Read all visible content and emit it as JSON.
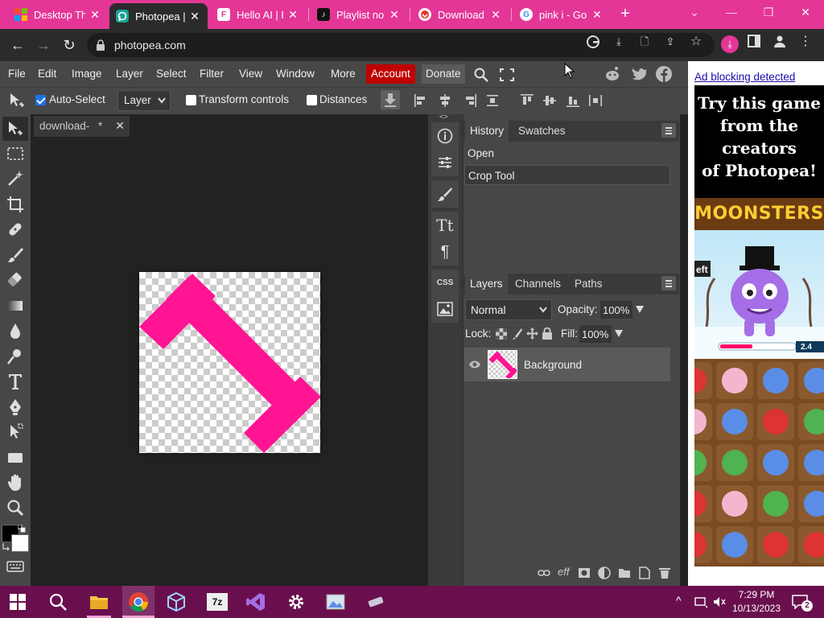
{
  "browser": {
    "tabs": [
      {
        "title": "Desktop Th",
        "favicon": "windows-flag-icon",
        "active": false
      },
      {
        "title": "Photopea |",
        "favicon": "photopea-icon",
        "active": true
      },
      {
        "title": "Hello AI | F",
        "favicon": "f-logo-icon",
        "active": false
      },
      {
        "title": "Playlist no",
        "favicon": "tiktok-icon",
        "active": false
      },
      {
        "title": "Download",
        "favicon": "download-site-icon",
        "active": false
      },
      {
        "title": "pink i - Go",
        "favicon": "google-icon",
        "active": false
      }
    ],
    "url": "photopea.com",
    "accent": "#e43697"
  },
  "menu": {
    "items": [
      "File",
      "Edit",
      "Image",
      "Layer",
      "Select",
      "Filter",
      "View",
      "Window",
      "More"
    ],
    "account": "Account",
    "donate": "Donate"
  },
  "options": {
    "auto_select": "Auto-Select",
    "auto_select_checked": true,
    "target": "Layer",
    "transform_controls": "Transform controls",
    "distances": "Distances"
  },
  "document": {
    "tab_title": "download-",
    "modified": "*",
    "art_color": "#ff1493"
  },
  "history": {
    "tabs": [
      "History",
      "Swatches"
    ],
    "items": [
      "Open",
      "Crop Tool"
    ]
  },
  "layers": {
    "tabs": [
      "Layers",
      "Channels",
      "Paths"
    ],
    "blend_mode": "Normal",
    "opacity_label": "Opacity:",
    "opacity": "100%",
    "lock_label": "Lock:",
    "fill_label": "Fill:",
    "fill": "100%",
    "layer_name": "Background"
  },
  "ad": {
    "notice": "Ad blocking detected",
    "headline": [
      "Try this game",
      "from the",
      "creators",
      "of Photopea!"
    ],
    "banner": "MOONSTERS",
    "game_label": "eft",
    "score": "2.4 EE"
  },
  "taskbar": {
    "time": "7:29 PM",
    "date": "10/13/2023",
    "notifications": "2"
  }
}
